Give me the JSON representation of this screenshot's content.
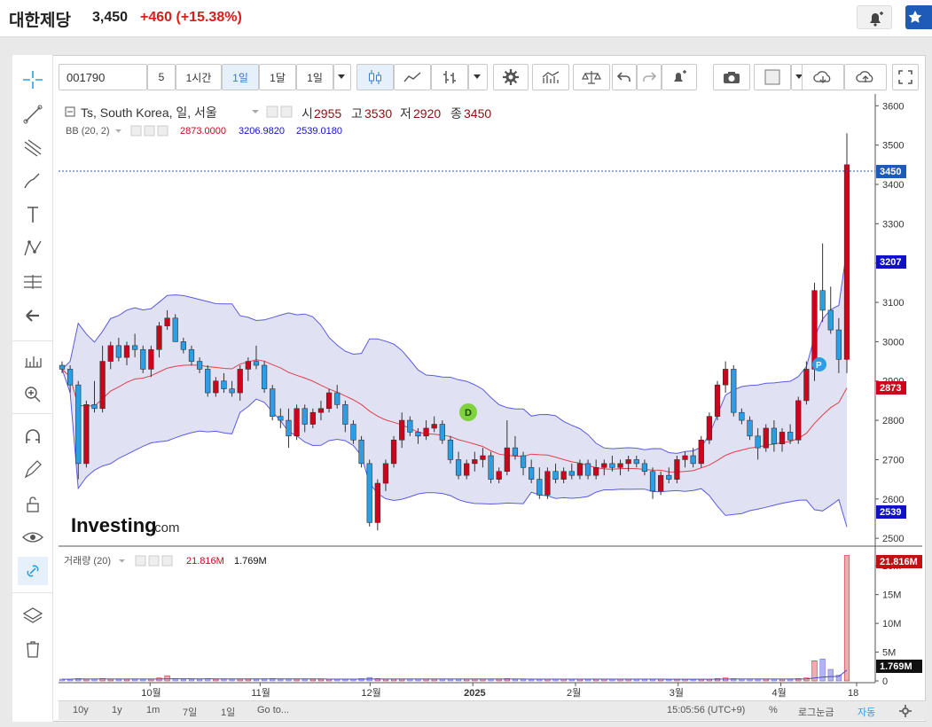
{
  "header": {
    "title": "대한제당",
    "price": "3,450",
    "change": "+460",
    "change_pct": "(+15.38%)"
  },
  "toolbar": {
    "symbol": "001790",
    "interval_number": "5",
    "intervals": [
      "1시간",
      "1일",
      "1달",
      "1일"
    ],
    "active_interval": "1일"
  },
  "legend": {
    "title": "Ts, South Korea, 일, 서울",
    "ohlc": {
      "open_label": "시",
      "open": "2955",
      "high_label": "고",
      "high": "3530",
      "low_label": "저",
      "low": "2920",
      "close_label": "종",
      "close": "3450"
    },
    "bb": {
      "label": "BB (20, 2)",
      "mid": "2873.0000",
      "upper": "3206.9820",
      "lower": "2539.0180"
    }
  },
  "volume_legend": {
    "label": "거래량 (20)",
    "value": "21.816M",
    "ma": "1.769M"
  },
  "price_axis": {
    "ticks": [
      "3600",
      "3500",
      "3400",
      "3300",
      "3200",
      "3100",
      "3000",
      "2900",
      "2800",
      "2700",
      "2600",
      "2500"
    ],
    "badges": {
      "close": "3450",
      "upper": "3207",
      "mid": "2873",
      "lower": "2539"
    }
  },
  "volume_axis": {
    "ticks": [
      "20M",
      "15M",
      "10M",
      "5M",
      "0"
    ],
    "badges": {
      "volume": "21.816M",
      "ma": "1.769M"
    }
  },
  "time_axis": {
    "labels": [
      "10월",
      "11월",
      "12월",
      "2025",
      "2월",
      "3월",
      "4월",
      "18"
    ]
  },
  "markers": {
    "dividend": "D",
    "split": "P"
  },
  "watermark": {
    "brand": "Investing",
    "domain": ".com"
  },
  "footer": {
    "ranges": [
      "10y",
      "1y",
      "1m",
      "7일",
      "1일"
    ],
    "goto": "Go to...",
    "time": "15:05:56 (UTC+9)",
    "percent": "%",
    "log": "로그눈금",
    "auto": "자동"
  },
  "colors": {
    "up": "#d0021b",
    "down": "#2b9fe6",
    "bb_band": "#5b5bdc",
    "bb_mid": "#e0404b",
    "bb_fill": "#dcdcf2"
  },
  "chart_data": {
    "type": "candlestick",
    "x_labels": [
      "10월",
      "11월",
      "12월",
      "2025",
      "2월",
      "3월",
      "4월",
      "18"
    ],
    "ylim": [
      2480,
      3630
    ],
    "ohlc_approx": [
      [
        2940,
        2950,
        2920,
        2930
      ],
      [
        2930,
        2940,
        2870,
        2890
      ],
      [
        2890,
        2900,
        2650,
        2690
      ],
      [
        2690,
        2850,
        2680,
        2840
      ],
      [
        2840,
        2900,
        2820,
        2830
      ],
      [
        2830,
        2990,
        2820,
        2950
      ],
      [
        2950,
        3000,
        2930,
        2990
      ],
      [
        2990,
        3010,
        2950,
        2960
      ],
      [
        2960,
        3000,
        2940,
        2990
      ],
      [
        2990,
        3020,
        2960,
        2980
      ],
      [
        2980,
        2990,
        2920,
        2930
      ],
      [
        2930,
        2990,
        2910,
        2980
      ],
      [
        2980,
        3050,
        2960,
        3040
      ],
      [
        3040,
        3080,
        3030,
        3060
      ],
      [
        3060,
        3070,
        3000,
        3000
      ],
      [
        3000,
        3010,
        2970,
        2980
      ],
      [
        2980,
        2990,
        2940,
        2950
      ],
      [
        2950,
        2960,
        2920,
        2930
      ],
      [
        2930,
        2940,
        2860,
        2870
      ],
      [
        2870,
        2910,
        2860,
        2900
      ],
      [
        2900,
        2920,
        2870,
        2880
      ],
      [
        2880,
        2900,
        2860,
        2870
      ],
      [
        2870,
        2940,
        2850,
        2930
      ],
      [
        2930,
        2960,
        2900,
        2950
      ],
      [
        2950,
        2990,
        2930,
        2940
      ],
      [
        2940,
        2950,
        2870,
        2880
      ],
      [
        2880,
        2890,
        2800,
        2810
      ],
      [
        2810,
        2830,
        2780,
        2800
      ],
      [
        2800,
        2830,
        2730,
        2760
      ],
      [
        2760,
        2840,
        2750,
        2830
      ],
      [
        2830,
        2840,
        2770,
        2790
      ],
      [
        2790,
        2830,
        2780,
        2820
      ],
      [
        2820,
        2850,
        2800,
        2830
      ],
      [
        2830,
        2880,
        2820,
        2870
      ],
      [
        2870,
        2890,
        2830,
        2840
      ],
      [
        2840,
        2850,
        2770,
        2790
      ],
      [
        2790,
        2800,
        2740,
        2750
      ],
      [
        2750,
        2760,
        2680,
        2690
      ],
      [
        2690,
        2700,
        2530,
        2540
      ],
      [
        2540,
        2650,
        2520,
        2640
      ],
      [
        2640,
        2700,
        2620,
        2690
      ],
      [
        2690,
        2760,
        2680,
        2750
      ],
      [
        2750,
        2820,
        2730,
        2800
      ],
      [
        2800,
        2810,
        2760,
        2770
      ],
      [
        2770,
        2780,
        2740,
        2760
      ],
      [
        2760,
        2800,
        2750,
        2780
      ],
      [
        2780,
        2810,
        2770,
        2790
      ],
      [
        2790,
        2800,
        2740,
        2750
      ],
      [
        2750,
        2760,
        2690,
        2700
      ],
      [
        2700,
        2720,
        2650,
        2660
      ],
      [
        2660,
        2700,
        2650,
        2690
      ],
      [
        2690,
        2720,
        2670,
        2700
      ],
      [
        2700,
        2730,
        2680,
        2710
      ],
      [
        2710,
        2720,
        2640,
        2650
      ],
      [
        2650,
        2680,
        2640,
        2670
      ],
      [
        2670,
        2800,
        2660,
        2730
      ],
      [
        2730,
        2760,
        2700,
        2710
      ],
      [
        2710,
        2720,
        2660,
        2680
      ],
      [
        2680,
        2700,
        2640,
        2650
      ],
      [
        2650,
        2680,
        2600,
        2610
      ],
      [
        2610,
        2680,
        2600,
        2670
      ],
      [
        2670,
        2690,
        2640,
        2650
      ],
      [
        2650,
        2680,
        2640,
        2670
      ],
      [
        2670,
        2690,
        2650,
        2660
      ],
      [
        2660,
        2700,
        2650,
        2690
      ],
      [
        2690,
        2700,
        2650,
        2660
      ],
      [
        2660,
        2700,
        2650,
        2680
      ],
      [
        2680,
        2700,
        2660,
        2690
      ],
      [
        2690,
        2710,
        2670,
        2680
      ],
      [
        2680,
        2700,
        2660,
        2690
      ],
      [
        2690,
        2710,
        2670,
        2700
      ],
      [
        2700,
        2710,
        2680,
        2690
      ],
      [
        2690,
        2700,
        2660,
        2670
      ],
      [
        2670,
        2680,
        2600,
        2620
      ],
      [
        2620,
        2670,
        2610,
        2660
      ],
      [
        2660,
        2680,
        2640,
        2650
      ],
      [
        2650,
        2710,
        2640,
        2700
      ],
      [
        2700,
        2720,
        2680,
        2710
      ],
      [
        2710,
        2730,
        2680,
        2690
      ],
      [
        2690,
        2760,
        2680,
        2750
      ],
      [
        2750,
        2820,
        2740,
        2810
      ],
      [
        2810,
        2900,
        2800,
        2890
      ],
      [
        2890,
        2950,
        2870,
        2930
      ],
      [
        2930,
        2940,
        2810,
        2820
      ],
      [
        2820,
        2830,
        2790,
        2800
      ],
      [
        2800,
        2810,
        2750,
        2760
      ],
      [
        2760,
        2780,
        2700,
        2730
      ],
      [
        2730,
        2790,
        2720,
        2780
      ],
      [
        2780,
        2800,
        2720,
        2740
      ],
      [
        2740,
        2780,
        2720,
        2770
      ],
      [
        2770,
        2790,
        2740,
        2750
      ],
      [
        2750,
        2860,
        2740,
        2850
      ],
      [
        2850,
        2950,
        2840,
        2930
      ],
      [
        2930,
        3150,
        2900,
        3130
      ],
      [
        3130,
        3250,
        3050,
        3080
      ],
      [
        3080,
        3140,
        3020,
        3030
      ],
      [
        3030,
        3060,
        2920,
        2955
      ],
      [
        2955,
        3530,
        2920,
        3450
      ]
    ],
    "volume_approx": [
      0.3,
      0.3,
      0.4,
      0.3,
      0.3,
      0.4,
      0.3,
      0.3,
      0.3,
      0.3,
      0.3,
      0.3,
      0.5,
      0.9,
      0.4,
      0.3,
      0.3,
      0.3,
      0.4,
      0.3,
      0.3,
      0.3,
      0.3,
      0.3,
      0.3,
      0.3,
      0.4,
      0.3,
      0.3,
      0.3,
      0.3,
      0.3,
      0.3,
      0.3,
      0.3,
      0.3,
      0.3,
      0.4,
      0.6,
      0.4,
      0.3,
      0.3,
      0.3,
      0.3,
      0.3,
      0.3,
      0.3,
      0.3,
      0.3,
      0.3,
      0.3,
      0.3,
      0.3,
      0.3,
      0.3,
      0.4,
      0.3,
      0.3,
      0.3,
      0.3,
      0.3,
      0.3,
      0.3,
      0.3,
      0.3,
      0.3,
      0.3,
      0.3,
      0.3,
      0.3,
      0.3,
      0.3,
      0.3,
      0.3,
      0.3,
      0.3,
      0.3,
      0.3,
      0.3,
      0.3,
      0.3,
      0.4,
      0.5,
      0.4,
      0.3,
      0.3,
      0.3,
      0.3,
      0.3,
      0.3,
      0.3,
      0.4,
      0.5,
      3.5,
      3.8,
      2.0,
      1.0,
      21.8
    ]
  }
}
